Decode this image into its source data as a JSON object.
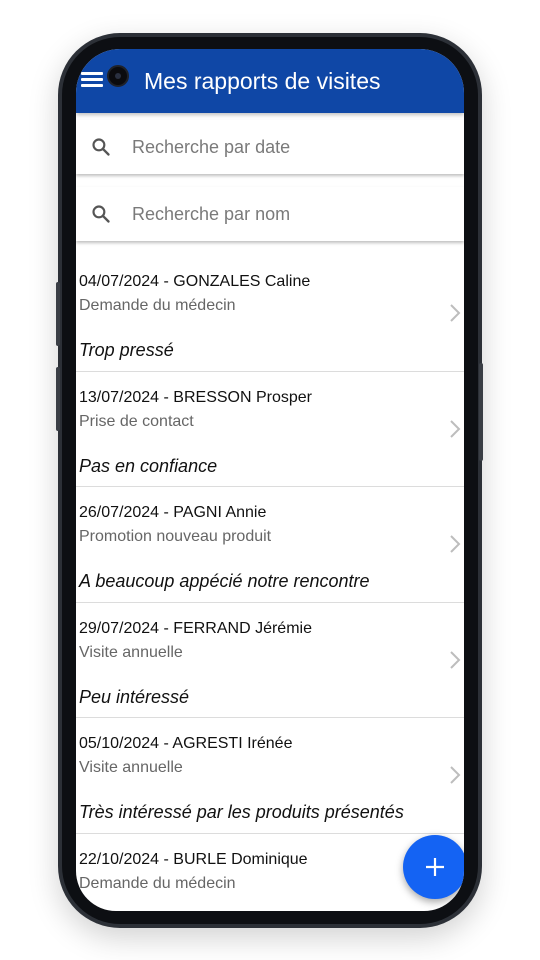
{
  "appbar": {
    "title": "Mes rapports de visites",
    "color": "#0f47a6"
  },
  "search_date": {
    "placeholder": "Recherche par date"
  },
  "search_name": {
    "placeholder": "Recherche par nom"
  },
  "reports": [
    {
      "title": "04/07/2024 - GONZALES Caline",
      "reason": "Demande du médecin",
      "comment": "Trop pressé"
    },
    {
      "title": "13/07/2024 - BRESSON Prosper",
      "reason": "Prise de contact",
      "comment": "Pas en confiance"
    },
    {
      "title": "26/07/2024 - PAGNI Annie",
      "reason": "Promotion nouveau produit",
      "comment": "A beaucoup appécié notre rencontre"
    },
    {
      "title": "29/07/2024 - FERRAND Jérémie",
      "reason": "Visite annuelle",
      "comment": "Peu intéressé"
    },
    {
      "title": "05/10/2024 - AGRESTI Irénée",
      "reason": "Visite annuelle",
      "comment": "Très intéressé par les produits présentés"
    },
    {
      "title": "22/10/2024 - BURLE Dominique",
      "reason": "Demande du médecin",
      "comment": ""
    }
  ],
  "fab": {
    "icon": "plus-icon",
    "color": "#1463f3"
  }
}
